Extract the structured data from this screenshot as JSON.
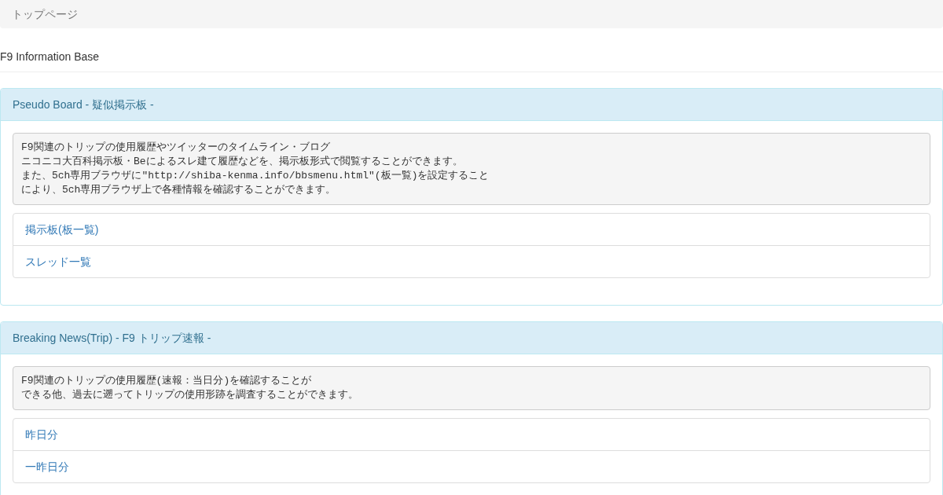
{
  "breadcrumb": "トップページ",
  "page_title": "F9 Information Base",
  "panels": [
    {
      "title": "Pseudo Board - 疑似掲示板 -",
      "description_lines": [
        "F9関連のトリップの使用履歴やツイッターのタイムライン・ブログ",
        "ニコニコ大百科掲示板・Beによるスレ建て履歴などを、掲示板形式で閲覧することができます。",
        "また、5ch専用ブラウザに\"http://shiba-kenma.info/bbsmenu.html\"(板一覧)を設定すること",
        "により、5ch専用ブラウザ上で各種情報を確認することができます。"
      ],
      "links": [
        "掲示板(板一覧)",
        "スレッド一覧"
      ]
    },
    {
      "title": "Breaking News(Trip) - F9 トリップ速報 -",
      "description_lines": [
        "F9関連のトリップの使用履歴(速報：当日分)を確認することが",
        "できる他、過去に遡ってトリップの使用形跡を調査することができます。"
      ],
      "links": [
        "昨日分",
        "一昨日分"
      ]
    }
  ]
}
